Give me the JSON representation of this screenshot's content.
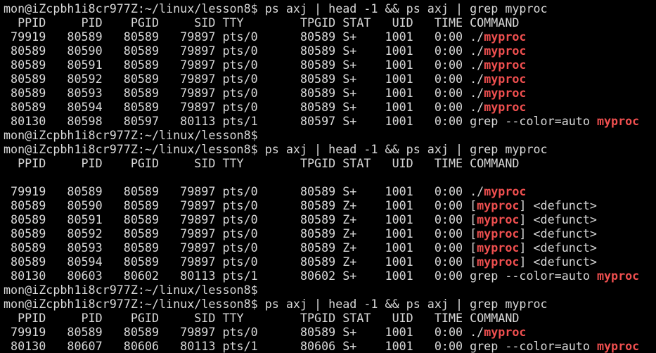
{
  "highlight_color": "#ef4f4f",
  "foreground_color": "#d8d8d8",
  "background_color": "#000000",
  "lines": [
    {
      "segments": [
        {
          "text": "mon@iZcpbh1i8cr977Z:~/linux/lesson8$ ps axj | head -1 && ps axj | grep myproc",
          "hl": false
        }
      ]
    },
    {
      "segments": [
        {
          "text": "  PPID     PID    PGID     SID TTY        TPGID STAT   UID   TIME COMMAND",
          "hl": false
        }
      ]
    },
    {
      "segments": [
        {
          "text": " 79919   80589   80589   79897 pts/0      80589 S+    1001   0:00 ./",
          "hl": false
        },
        {
          "text": "myproc",
          "hl": true
        }
      ]
    },
    {
      "segments": [
        {
          "text": " 80589   80590   80589   79897 pts/0      80589 S+    1001   0:00 ./",
          "hl": false
        },
        {
          "text": "myproc",
          "hl": true
        }
      ]
    },
    {
      "segments": [
        {
          "text": " 80589   80591   80589   79897 pts/0      80589 S+    1001   0:00 ./",
          "hl": false
        },
        {
          "text": "myproc",
          "hl": true
        }
      ]
    },
    {
      "segments": [
        {
          "text": " 80589   80592   80589   79897 pts/0      80589 S+    1001   0:00 ./",
          "hl": false
        },
        {
          "text": "myproc",
          "hl": true
        }
      ]
    },
    {
      "segments": [
        {
          "text": " 80589   80593   80589   79897 pts/0      80589 S+    1001   0:00 ./",
          "hl": false
        },
        {
          "text": "myproc",
          "hl": true
        }
      ]
    },
    {
      "segments": [
        {
          "text": " 80589   80594   80589   79897 pts/0      80589 S+    1001   0:00 ./",
          "hl": false
        },
        {
          "text": "myproc",
          "hl": true
        }
      ]
    },
    {
      "segments": [
        {
          "text": " 80130   80598   80597   80113 pts/1      80597 S+    1001   0:00 grep --color=auto ",
          "hl": false
        },
        {
          "text": "myproc",
          "hl": true
        }
      ]
    },
    {
      "segments": [
        {
          "text": "mon@iZcpbh1i8cr977Z:~/linux/lesson8$",
          "hl": false
        }
      ]
    },
    {
      "segments": [
        {
          "text": "mon@iZcpbh1i8cr977Z:~/linux/lesson8$ ps axj | head -1 && ps axj | grep myproc",
          "hl": false
        }
      ]
    },
    {
      "segments": [
        {
          "text": "  PPID     PID    PGID     SID TTY        TPGID STAT   UID   TIME COMMAND",
          "hl": false
        }
      ]
    },
    {
      "segments": [
        {
          "text": "",
          "hl": false
        }
      ]
    },
    {
      "segments": [
        {
          "text": " 79919   80589   80589   79897 pts/0      80589 S+    1001   0:00 ./",
          "hl": false
        },
        {
          "text": "myproc",
          "hl": true
        }
      ]
    },
    {
      "segments": [
        {
          "text": " 80589   80590   80589   79897 pts/0      80589 Z+    1001   0:00 [",
          "hl": false
        },
        {
          "text": "myproc",
          "hl": true
        },
        {
          "text": "] <defunct>",
          "hl": false
        }
      ]
    },
    {
      "segments": [
        {
          "text": " 80589   80591   80589   79897 pts/0      80589 Z+    1001   0:00 [",
          "hl": false
        },
        {
          "text": "myproc",
          "hl": true
        },
        {
          "text": "] <defunct>",
          "hl": false
        }
      ]
    },
    {
      "segments": [
        {
          "text": " 80589   80592   80589   79897 pts/0      80589 Z+    1001   0:00 [",
          "hl": false
        },
        {
          "text": "myproc",
          "hl": true
        },
        {
          "text": "] <defunct>",
          "hl": false
        }
      ]
    },
    {
      "segments": [
        {
          "text": " 80589   80593   80589   79897 pts/0      80589 Z+    1001   0:00 [",
          "hl": false
        },
        {
          "text": "myproc",
          "hl": true
        },
        {
          "text": "] <defunct>",
          "hl": false
        }
      ]
    },
    {
      "segments": [
        {
          "text": " 80589   80594   80589   79897 pts/0      80589 Z+    1001   0:00 [",
          "hl": false
        },
        {
          "text": "myproc",
          "hl": true
        },
        {
          "text": "] <defunct>",
          "hl": false
        }
      ]
    },
    {
      "segments": [
        {
          "text": " 80130   80603   80602   80113 pts/1      80602 S+    1001   0:00 grep --color=auto ",
          "hl": false
        },
        {
          "text": "myproc",
          "hl": true
        }
      ]
    },
    {
      "segments": [
        {
          "text": "mon@iZcpbh1i8cr977Z:~/linux/lesson8$",
          "hl": false
        }
      ]
    },
    {
      "segments": [
        {
          "text": "mon@iZcpbh1i8cr977Z:~/linux/lesson8$ ps axj | head -1 && ps axj | grep myproc",
          "hl": false
        }
      ]
    },
    {
      "segments": [
        {
          "text": "  PPID     PID    PGID     SID TTY        TPGID STAT   UID   TIME COMMAND",
          "hl": false
        }
      ]
    },
    {
      "segments": [
        {
          "text": " 79919   80589   80589   79897 pts/0      80589 S+    1001   0:00 ./",
          "hl": false
        },
        {
          "text": "myproc",
          "hl": true
        }
      ]
    },
    {
      "segments": [
        {
          "text": " 80130   80607   80606   80113 pts/1      80606 S+    1001   0:00 grep --color=auto ",
          "hl": false
        },
        {
          "text": "myproc",
          "hl": true
        }
      ]
    }
  ]
}
